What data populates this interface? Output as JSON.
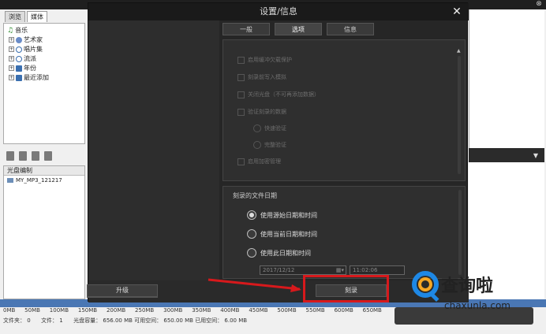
{
  "background_app": {
    "tabs": [
      "浏览",
      "媒体"
    ],
    "tree_items": [
      {
        "label": "音乐",
        "icon": "music-note-icon"
      },
      {
        "label": "艺术家",
        "icon": "person-icon"
      },
      {
        "label": "唱片集",
        "icon": "album-icon"
      },
      {
        "label": "流派",
        "icon": "genre-icon"
      },
      {
        "label": "年份",
        "icon": "calendar-icon"
      },
      {
        "label": "最近添加",
        "icon": "recent-icon"
      }
    ],
    "disc_panel": {
      "header": "光盘编制",
      "items": [
        "MY_MP3_121217"
      ]
    },
    "ruler_labels": [
      "0MB",
      "50MB",
      "100MB",
      "150MB",
      "200MB",
      "250MB",
      "300MB",
      "350MB",
      "400MB",
      "450MB",
      "500MB",
      "550MB",
      "600MB",
      "650MB"
    ],
    "status": {
      "folders_label": "文件夹：",
      "folders": "0",
      "files_label": "文件：",
      "files": "1",
      "capacity_label": "光盘容量：",
      "capacity": "656.00 MB",
      "free_label": "可用空间：",
      "free": "650.00 MB",
      "used_label": "已用空间：",
      "used": "6.00 MB"
    }
  },
  "dialog": {
    "title": "设置/信息",
    "tabs": [
      "一般",
      "选项",
      "信息"
    ],
    "active_tab": "选项",
    "options": [
      {
        "label": "启用缓冲欠载保护",
        "indent": false,
        "type": "checkbox"
      },
      {
        "label": "刻录前写入模拟",
        "indent": false,
        "type": "checkbox"
      },
      {
        "label": "关闭光盘（不可再添加数据）",
        "indent": false,
        "type": "checkbox"
      },
      {
        "label": "验证刻录的数据",
        "indent": false,
        "type": "checkbox"
      },
      {
        "label": "快速验证",
        "indent": true,
        "type": "radio"
      },
      {
        "label": "完整验证",
        "indent": true,
        "type": "radio"
      },
      {
        "label": "启用加密管理",
        "indent": false,
        "type": "checkbox"
      }
    ],
    "date_section": {
      "title": "刻录的文件日期",
      "choices": [
        "使用源始日期和时间",
        "使用当前日期和时间",
        "使用此日期和时间"
      ],
      "selected": "使用源始日期和时间",
      "date_value": "2017/12/12",
      "time_value": "11:02:06"
    },
    "buttons": {
      "upgrade": "升级",
      "burn": "刻录"
    }
  },
  "watermark": {
    "text": "查询啦",
    "url": "chaxunla.com"
  },
  "colors": {
    "dialog_bg": "#262626",
    "ruler": "#4a77b4",
    "highlight": "#d7191c"
  }
}
